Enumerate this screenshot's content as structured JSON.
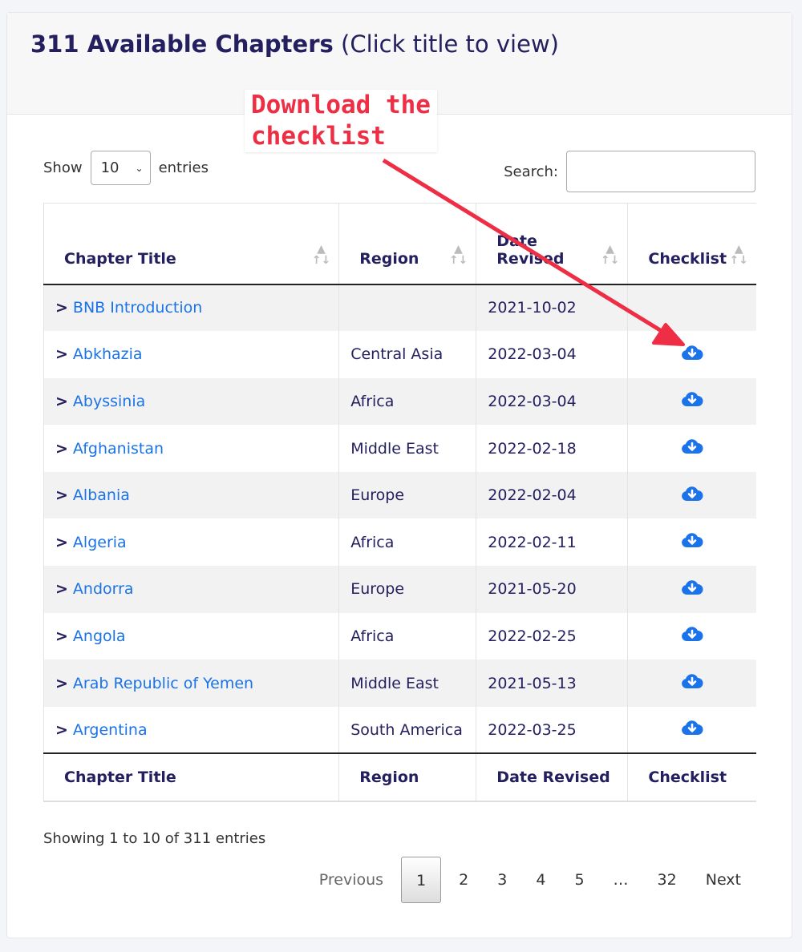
{
  "header": {
    "title_bold": "311 Available Chapters",
    "title_note": "(Click title to view)"
  },
  "length": {
    "show": "Show",
    "value": "10",
    "entries": "entries"
  },
  "search": {
    "label": "Search:",
    "value": ""
  },
  "columns": [
    "Chapter Title",
    "Region",
    "Date Revised",
    "Checklist"
  ],
  "rows": [
    {
      "title": "BNB Introduction",
      "region": "",
      "date": "2021-10-02",
      "checklist": false
    },
    {
      "title": "Abkhazia",
      "region": "Central Asia",
      "date": "2022-03-04",
      "checklist": true
    },
    {
      "title": "Abyssinia",
      "region": "Africa",
      "date": "2022-03-04",
      "checklist": true
    },
    {
      "title": "Afghanistan",
      "region": "Middle East",
      "date": "2022-02-18",
      "checklist": true
    },
    {
      "title": "Albania",
      "region": "Europe",
      "date": "2022-02-04",
      "checklist": true
    },
    {
      "title": "Algeria",
      "region": "Africa",
      "date": "2022-02-11",
      "checklist": true
    },
    {
      "title": "Andorra",
      "region": "Europe",
      "date": "2021-05-20",
      "checklist": true
    },
    {
      "title": "Angola",
      "region": "Africa",
      "date": "2022-02-25",
      "checklist": true
    },
    {
      "title": "Arab Republic of Yemen",
      "region": "Middle East",
      "date": "2021-05-13",
      "checklist": true
    },
    {
      "title": "Argentina",
      "region": "South America",
      "date": "2022-03-25",
      "checklist": true
    }
  ],
  "info": "Showing 1 to 10 of 311 entries",
  "pager": {
    "previous": "Previous",
    "pages": [
      "1",
      "2",
      "3",
      "4",
      "5",
      "…",
      "32"
    ],
    "current": "1",
    "next": "Next"
  },
  "annotation": {
    "line1": "Download the",
    "line2": "checklist",
    "color": "#ee2e44"
  },
  "colors": {
    "link": "#1a73e8",
    "heading": "#24205f",
    "icon": "#1a73e8"
  }
}
